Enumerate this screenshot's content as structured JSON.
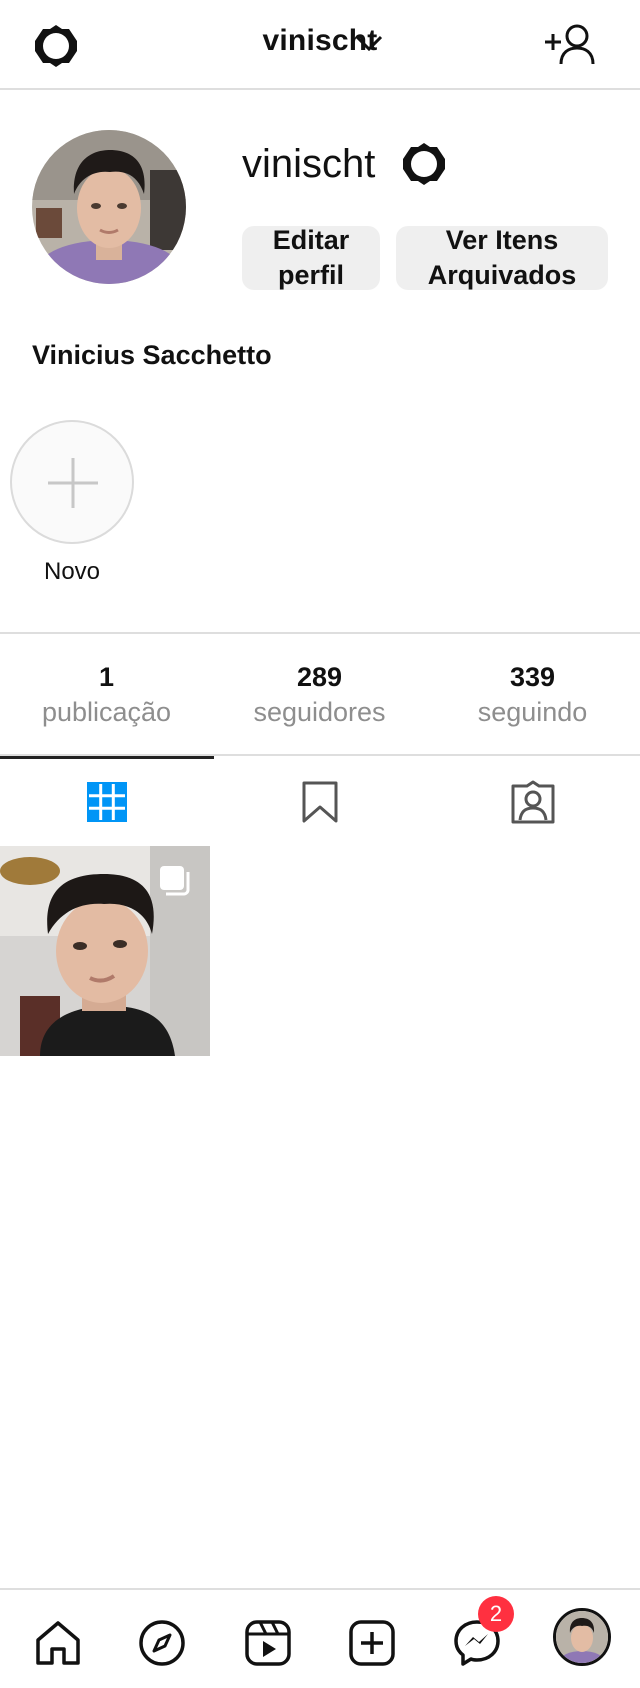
{
  "header": {
    "title": "vinischt",
    "settings_icon": "gear-icon",
    "switch_icon": "chevron-down-icon",
    "add_user_icon": "add-user-icon"
  },
  "profile": {
    "username": "vinischt",
    "buttons": {
      "edit_line1": "Editar",
      "edit_line2": "perfil",
      "archive_line1": "Ver Itens",
      "archive_line2": "Arquivados"
    },
    "full_name": "Vinicius Sacchetto"
  },
  "stories": {
    "new_label": "Novo"
  },
  "stats": {
    "posts": {
      "value": "1",
      "label": "publicação"
    },
    "followers": {
      "value": "289",
      "label": "seguidores"
    },
    "following": {
      "value": "339",
      "label": "seguindo"
    }
  },
  "tabs": [
    {
      "icon": "grid-icon",
      "active": true
    },
    {
      "icon": "bookmark-icon",
      "active": false
    },
    {
      "icon": "tagged-icon",
      "active": false
    }
  ],
  "bottom_nav": {
    "items": [
      "home-icon",
      "explore-icon",
      "reels-icon",
      "new-post-icon",
      "messenger-icon",
      "profile-avatar"
    ],
    "messenger_badge": "2"
  },
  "colors": {
    "accent": "#0095f6",
    "badge": "#ff3040",
    "muted_text": "#8e8e8e",
    "button_bg": "#efefef"
  }
}
